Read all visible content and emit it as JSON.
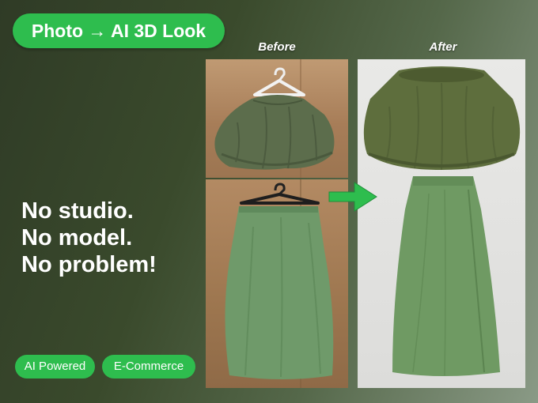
{
  "header": {
    "title": "Photo → AI 3D Look"
  },
  "comparison": {
    "before_label": "Before",
    "after_label": "After"
  },
  "headline": {
    "lines": [
      "No studio.",
      "No model.",
      "No problem!"
    ]
  },
  "tags": [
    "AI Powered",
    "E-Commerce"
  ],
  "colors": {
    "accent_green": "#2ebd4e",
    "garment_top": "#5f6e3e",
    "garment_skirt": "#6f9a63",
    "wood_background": "#a87f58"
  },
  "icons": [
    "hanger-icon",
    "arrow-right-icon"
  ]
}
